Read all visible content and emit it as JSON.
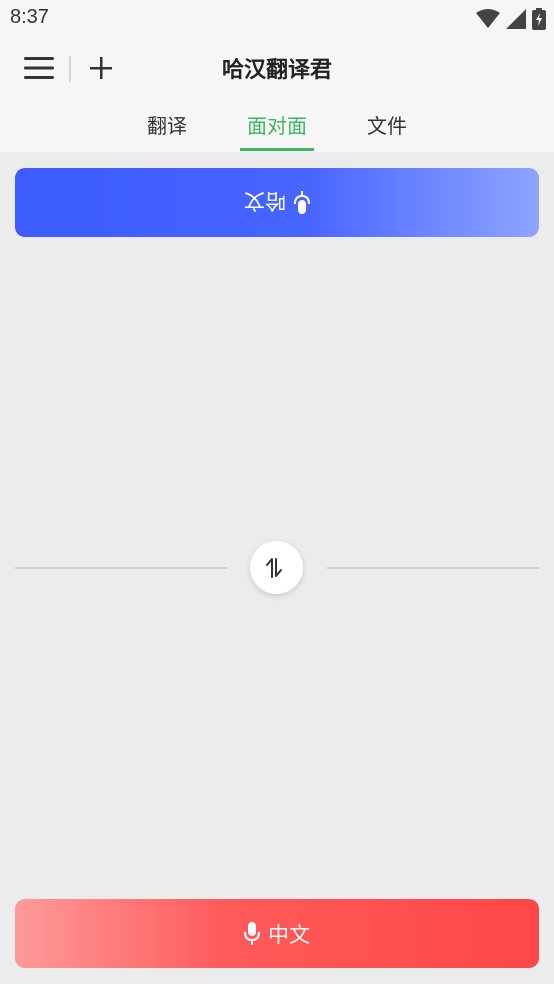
{
  "status_bar": {
    "time": "8:37",
    "icons": [
      "wifi-icon",
      "signal-icon",
      "battery-charging-icon"
    ]
  },
  "header": {
    "title": "哈汉翻译君",
    "menu_icon": "hamburger-menu-icon",
    "add_icon": "plus-icon"
  },
  "tabs": [
    {
      "label": "翻译",
      "active": false
    },
    {
      "label": "面对面",
      "active": true
    },
    {
      "label": "文件",
      "active": false
    }
  ],
  "top_speaker": {
    "label": "哈文",
    "icon": "microphone-icon",
    "orientation": "upside-down",
    "color": "#3d5cff"
  },
  "swap": {
    "icon": "swap-arrows-icon"
  },
  "bottom_speaker": {
    "label": "中文",
    "icon": "microphone-icon",
    "color": "#ff4747"
  },
  "colors": {
    "accent": "#3fb560",
    "background": "#ececec"
  }
}
